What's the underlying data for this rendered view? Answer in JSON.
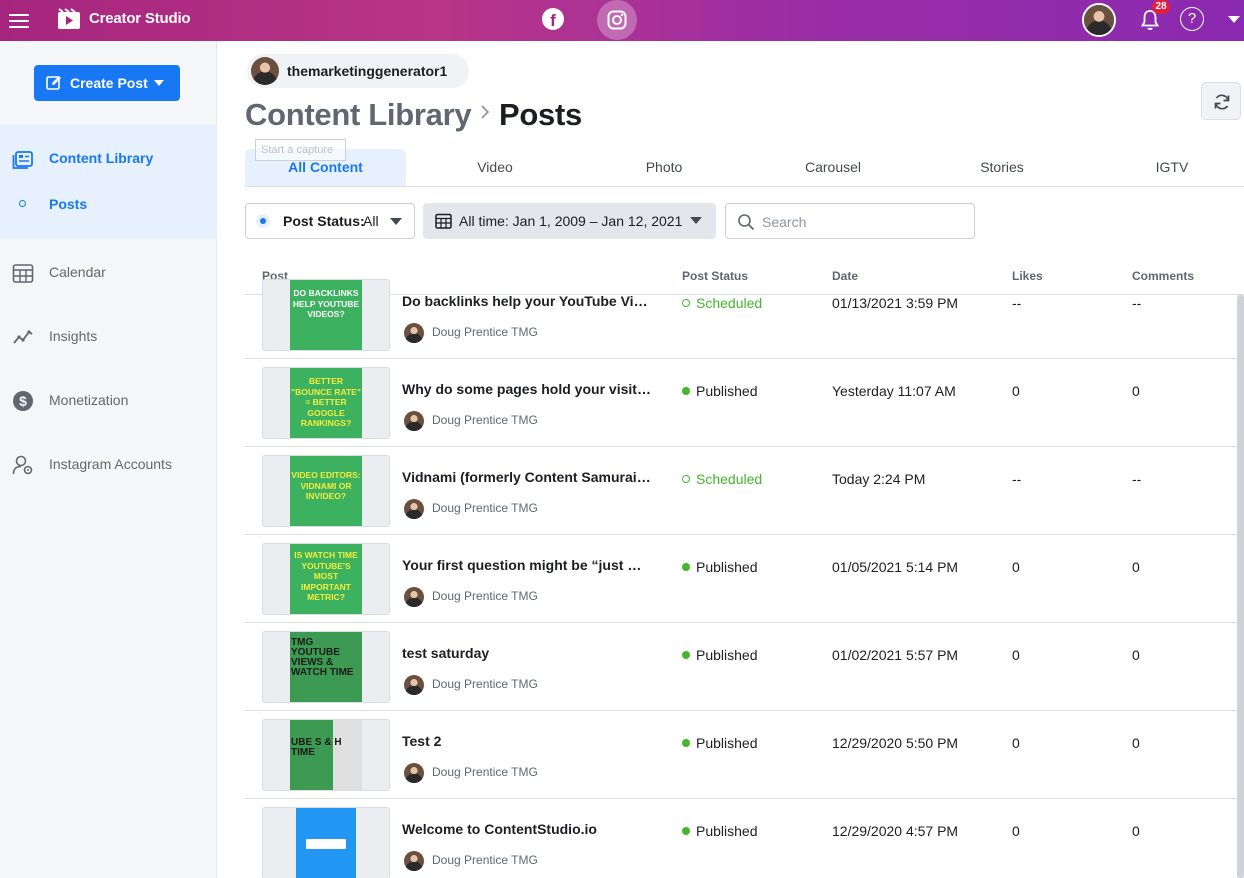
{
  "app": {
    "title": "Creator Studio",
    "notification_count": "28",
    "help_label": "?",
    "facebook_label": "f"
  },
  "sidebar": {
    "create_post_label": "Create Post",
    "items": [
      {
        "label": "Content Library",
        "icon": "content-library-icon"
      },
      {
        "label": "Posts",
        "icon": "bullet-icon"
      },
      {
        "label": "Calendar",
        "icon": "calendar-icon"
      },
      {
        "label": "Insights",
        "icon": "insights-icon"
      },
      {
        "label": "Monetization",
        "icon": "dollar-icon"
      },
      {
        "label": "Instagram Accounts",
        "icon": "account-settings-icon"
      }
    ]
  },
  "account": {
    "name": "themarketinggenerator1"
  },
  "breadcrumb": {
    "root": "Content Library",
    "current": "Posts"
  },
  "tooltip": "Start a capture",
  "tabs": [
    "All Content",
    "Video",
    "Photo",
    "Carousel",
    "Stories",
    "IGTV"
  ],
  "filters": {
    "status_label": "Post Status:",
    "status_value": "All",
    "date_value": "All time: Jan 1, 2009 – Jan 12, 2021",
    "search_placeholder": "Search"
  },
  "table": {
    "headers": [
      "Post",
      "Post Status",
      "Date",
      "Likes",
      "Comments"
    ],
    "rows": [
      {
        "title": "Do backlinks help your YouTube Vide…",
        "author": "Doug Prentice TMG",
        "status": "Scheduled",
        "date": "01/13/2021 3:59 PM",
        "likes": "--",
        "comments": "--",
        "thumb_text": "DO BACKLINKS HELP YOUTUBE VIDEOS?"
      },
      {
        "title": "Why do some pages hold your visitors…",
        "author": "Doug Prentice TMG",
        "status": "Published",
        "date": "Yesterday 11:07 AM",
        "likes": "0",
        "comments": "0",
        "thumb_text": "BETTER \"BOUNCE RATE\" = BETTER GOOGLE RANKINGS?"
      },
      {
        "title": "Vidnami (formerly Content Samurai) …",
        "author": "Doug Prentice TMG",
        "status": "Scheduled",
        "date": "Today 2:24 PM",
        "likes": "--",
        "comments": "--",
        "thumb_text": "VIDEO EDITORS: VIDNAMI OR INVIDEO?"
      },
      {
        "title": "Your first question might be “just wha…",
        "author": "Doug Prentice TMG",
        "status": "Published",
        "date": "01/05/2021 5:14 PM",
        "likes": "0",
        "comments": "0",
        "thumb_text": "IS WATCH TIME YOUTUBE'S MOST IMPORTANT METRIC?"
      },
      {
        "title": "test saturday",
        "author": "Doug Prentice TMG",
        "status": "Published",
        "date": "01/02/2021 5:57 PM",
        "likes": "0",
        "comments": "0",
        "thumb_text": "TMG YouTube Views & Watch Time"
      },
      {
        "title": "Test 2",
        "author": "Doug Prentice TMG",
        "status": "Published",
        "date": "12/29/2020 5:50 PM",
        "likes": "0",
        "comments": "0",
        "thumb_text": "ube s & h Time"
      },
      {
        "title": "Welcome to ContentStudio.io",
        "author": "Doug Prentice TMG",
        "status": "Published",
        "date": "12/29/2020 4:57 PM",
        "likes": "0",
        "comments": "0",
        "thumb_text": ""
      }
    ]
  },
  "colors": {
    "accent": "#1877f2",
    "published": "#42b72a",
    "topbar_start": "#a6267e",
    "topbar_end": "#8a2ab0"
  }
}
